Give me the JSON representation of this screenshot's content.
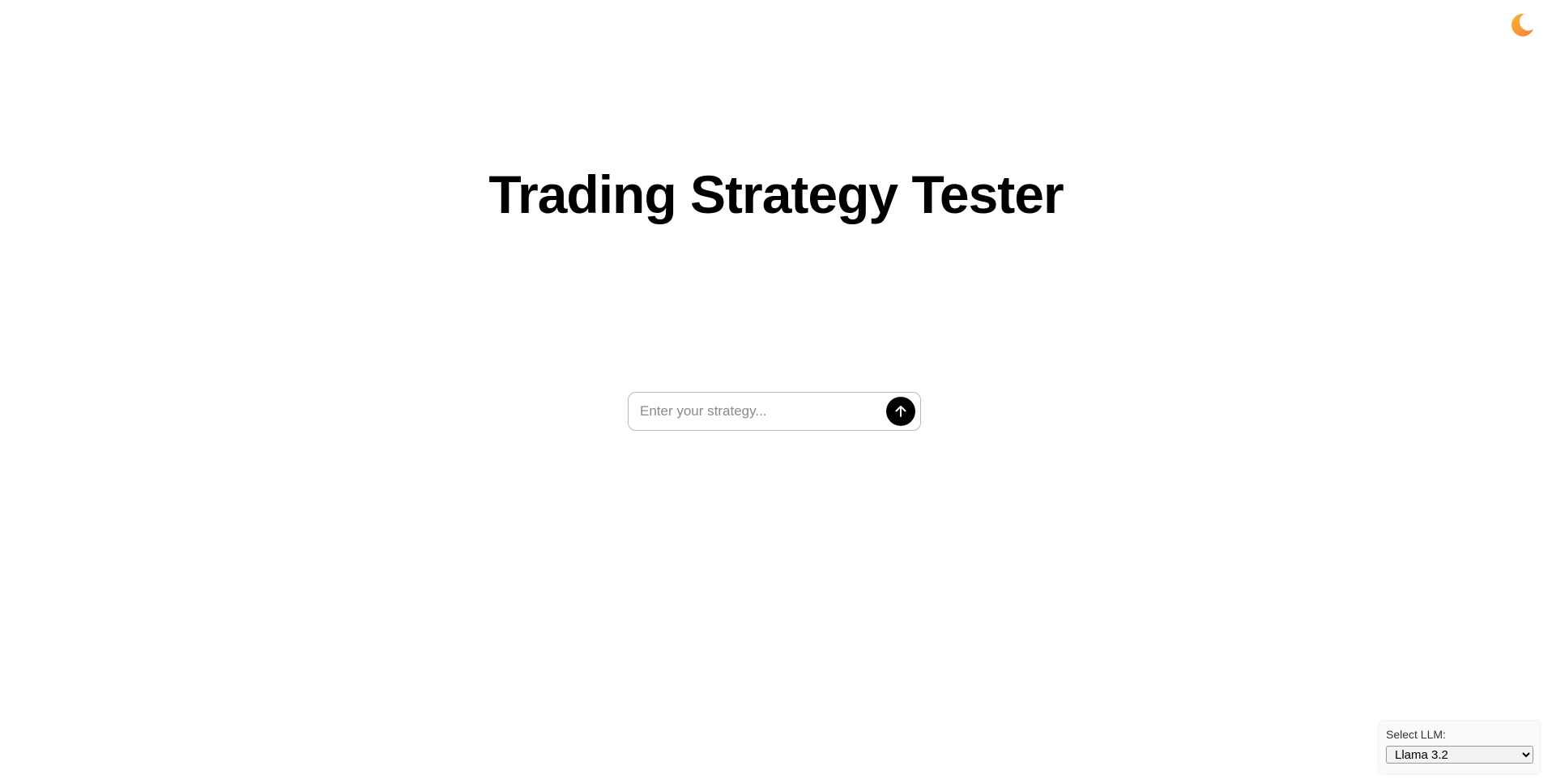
{
  "header": {
    "theme_toggle_icon": "moon-icon",
    "theme_toggle_color": "#f5a623"
  },
  "main": {
    "title": "Trading Strategy Tester",
    "strategy_input": {
      "value": "",
      "placeholder": "Enter your strategy..."
    },
    "submit_icon": "arrow-up-icon"
  },
  "llm_selector": {
    "label": "Select LLM:",
    "selected": "Llama 3.2"
  }
}
